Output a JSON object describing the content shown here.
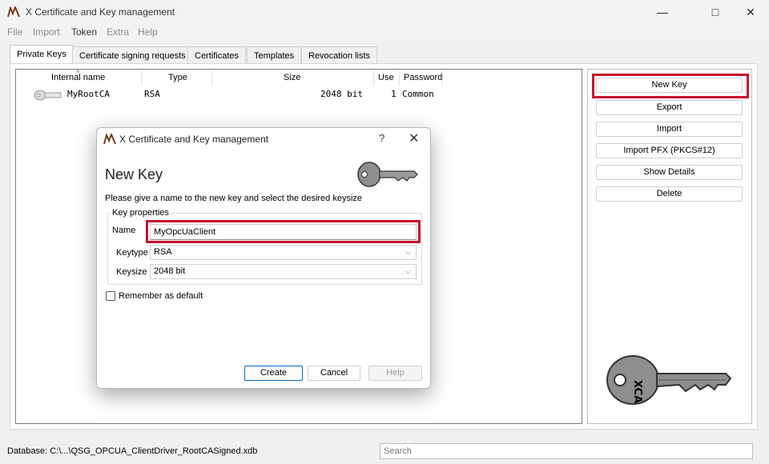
{
  "window": {
    "title": "X Certificate and Key management"
  },
  "menu": [
    "File",
    "Import",
    "Token",
    "Extra",
    "Help"
  ],
  "tabs": [
    "Private Keys",
    "Certificate signing requests",
    "Certificates",
    "Templates",
    "Revocation lists"
  ],
  "table": {
    "headers": [
      "Internal name",
      "Type",
      "Size",
      "Use",
      "Password"
    ],
    "rows": [
      {
        "name": "MyRootCA",
        "type": "RSA",
        "size": "2048 bit",
        "use": "1",
        "password": "Common"
      }
    ]
  },
  "buttons": {
    "new_key": "New Key",
    "export": "Export",
    "import": "Import",
    "import_pfx": "Import PFX (PKCS#12)",
    "show_details": "Show Details",
    "delete": "Delete"
  },
  "dialog": {
    "title": "X Certificate and Key management",
    "help_glyph": "?",
    "close_glyph": "✕",
    "heading": "New Key",
    "description": "Please give a name to the new key and select the desired keysize",
    "group": "Key properties",
    "name_label": "Name",
    "name_value": "MyOpcUaClient",
    "keytype_label": "Keytype",
    "keytype_value": "RSA",
    "keysize_label": "Keysize",
    "keysize_value": "2048 bit",
    "remember_label": "Remember as default",
    "create": "Create",
    "cancel": "Cancel",
    "help": "Help"
  },
  "key_art_text": "XCA",
  "status": {
    "database": "Database: C:\\...\\QSG_OPCUA_ClientDriver_RootCASigned.xdb",
    "search_placeholder": "Search"
  },
  "colors": {
    "highlight": "#c8102e",
    "default_button_border": "#0067c0"
  }
}
